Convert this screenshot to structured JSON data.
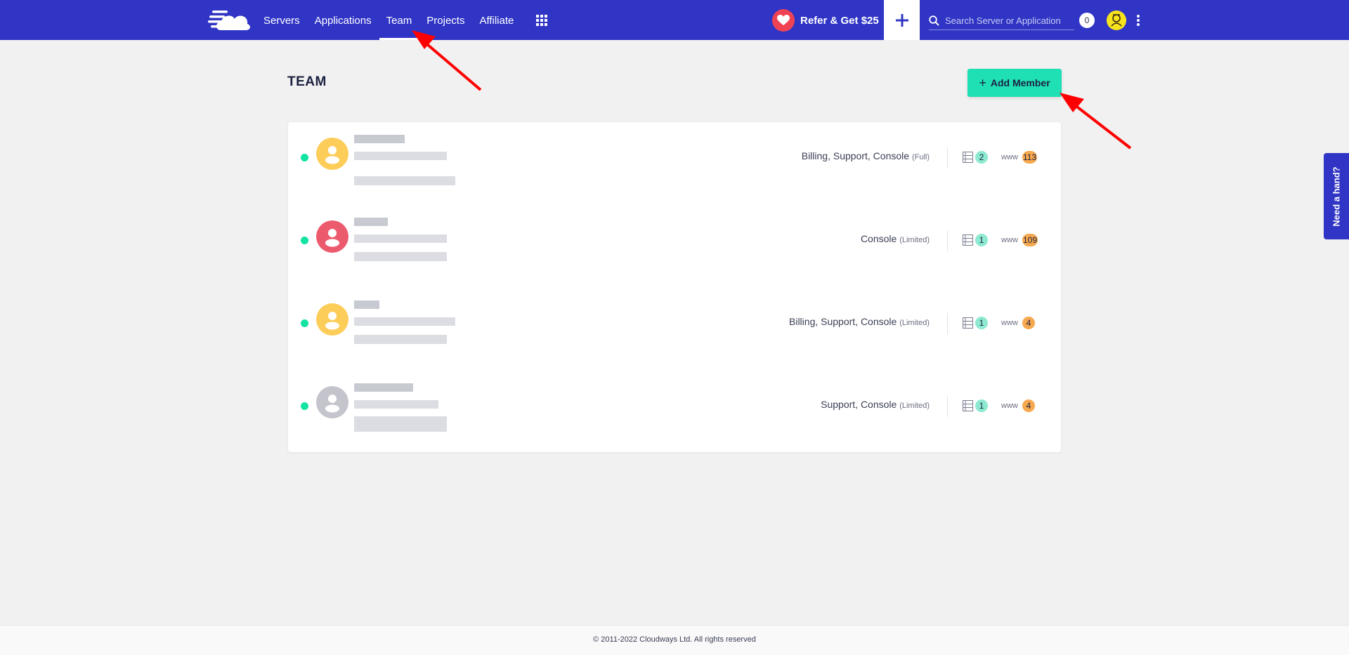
{
  "nav": {
    "items": [
      {
        "label": "Servers",
        "active": false
      },
      {
        "label": "Applications",
        "active": false
      },
      {
        "label": "Team",
        "active": true
      },
      {
        "label": "Projects",
        "active": false
      },
      {
        "label": "Affiliate",
        "active": false
      }
    ],
    "refer_label": "Refer & Get $25",
    "search_placeholder": "Search Server or Application",
    "notification_count": "0"
  },
  "page": {
    "title": "TEAM",
    "add_member_label": "Add Member"
  },
  "members": [
    {
      "permissions": "Billing, Support, Console",
      "level": "(Full)",
      "servers": "2",
      "apps": "113",
      "avatar_color": "#fdcd5a"
    },
    {
      "permissions": "Console",
      "level": "(Limited)",
      "servers": "1",
      "apps": "109",
      "avatar_color": "#ec5a6e"
    },
    {
      "permissions": "Billing, Support, Console",
      "level": "(Limited)",
      "servers": "1",
      "apps": "4",
      "avatar_color": "#fdcd5a"
    },
    {
      "permissions": "Support, Console",
      "level": "(Limited)",
      "servers": "1",
      "apps": "4",
      "avatar_color": "#c3c4cc"
    }
  ],
  "www_label": "www",
  "help_tab_label": "Need a hand?",
  "footer_text": "© 2011-2022 Cloudways Ltd. All rights reserved",
  "colors": {
    "brand": "#3035c5",
    "accent": "#1fe0b5",
    "status_active": "#12e3a3",
    "annotation": "#ff0000"
  }
}
